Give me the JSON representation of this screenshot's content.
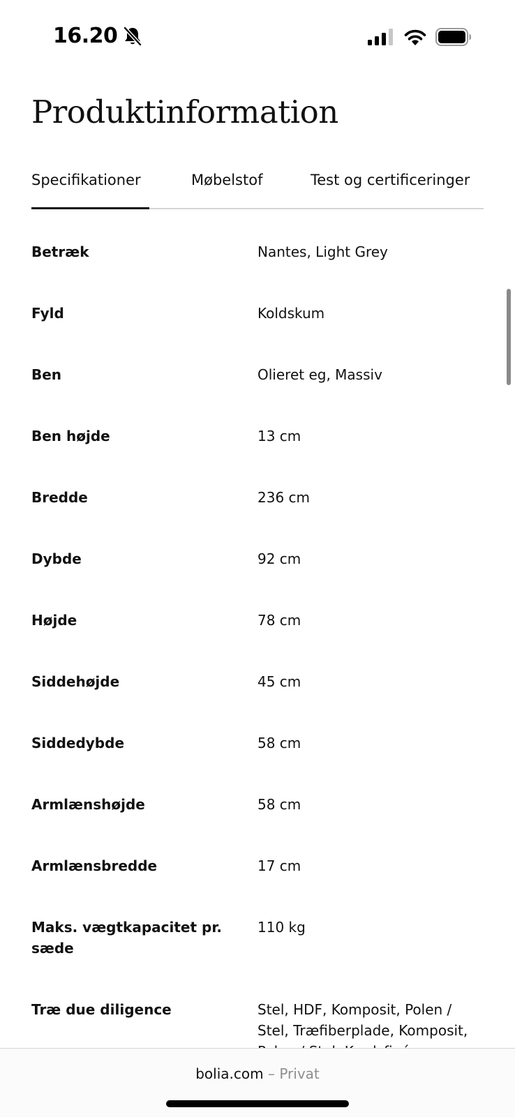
{
  "status_bar": {
    "time": "16.20",
    "icons": [
      "bell-slash-icon",
      "cellular-signal-icon",
      "wifi-icon",
      "battery-icon"
    ]
  },
  "page": {
    "title": "Produktinformation"
  },
  "tabs": [
    {
      "label": "Specifikationer",
      "active": true
    },
    {
      "label": "Møbelstof",
      "active": false
    },
    {
      "label": "Test og certificeringer",
      "active": false
    }
  ],
  "specs": [
    {
      "label": "Betræk",
      "value": "Nantes, Light Grey"
    },
    {
      "label": "Fyld",
      "value": "Koldskum"
    },
    {
      "label": "Ben",
      "value": "Olieret eg, Massiv"
    },
    {
      "label": "Ben højde",
      "value": "13 cm"
    },
    {
      "label": "Bredde",
      "value": "236 cm"
    },
    {
      "label": "Dybde",
      "value": "92 cm"
    },
    {
      "label": "Højde",
      "value": "78 cm"
    },
    {
      "label": "Siddehøjde",
      "value": "45 cm"
    },
    {
      "label": "Siddedybde",
      "value": "58 cm"
    },
    {
      "label": "Armlænshøjde",
      "value": "58 cm"
    },
    {
      "label": "Armlænsbredde",
      "value": "17 cm"
    },
    {
      "label": "Maks. vægtkapacitet pr. sæde",
      "value": "110 kg"
    },
    {
      "label": "Træ due diligence",
      "value": "Stel, HDF, Komposit, Polen / Stel, Træfiberplade, Komposit, Polen / Stel, Krydsfinér, Komposit, Pinus nigra, Tyrkiet / Stel, Massiv, Fyr, Pinus sylvestris, Polen / Stel, Massiv, Bøg, Fagus sylvatica, Polen"
    }
  ],
  "browser": {
    "domain": "bolia.com",
    "separator": "–",
    "mode": "Privat"
  },
  "colors": {
    "text": "#111111",
    "tab_divider": "#d5d5d5",
    "muted": "#8e8e8e",
    "background": "#ffffff"
  }
}
